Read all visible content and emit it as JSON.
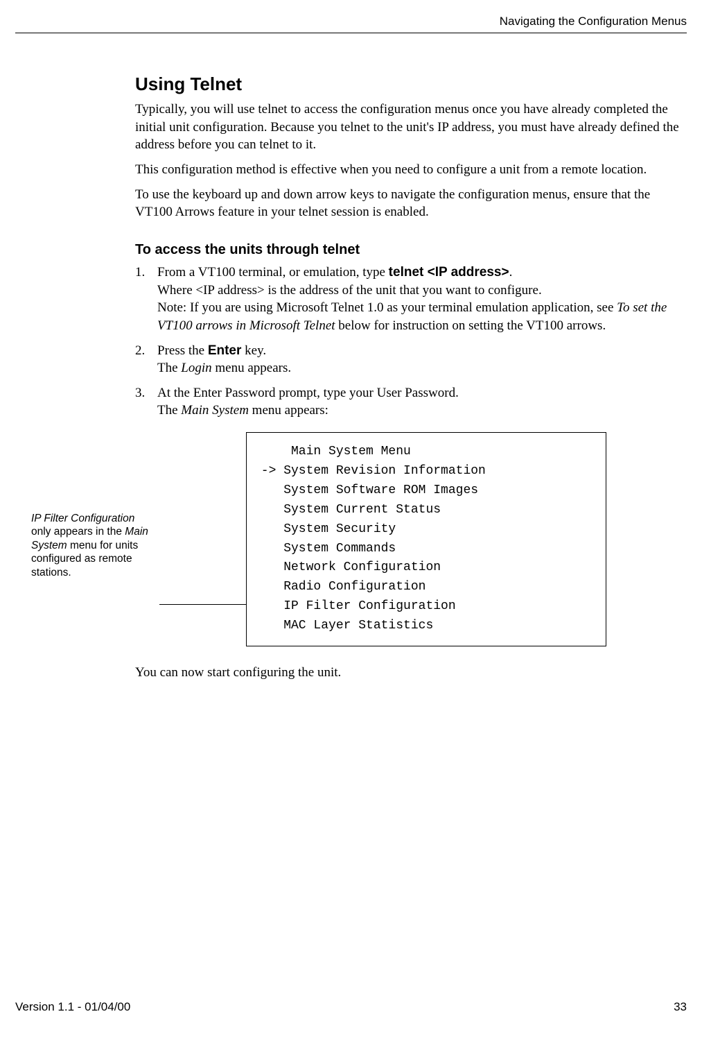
{
  "header": {
    "running_head": "Navigating the Configuration Menus"
  },
  "section": {
    "title": "Using Telnet",
    "para1": "Typically, you will use telnet to access the configuration menus once you have already completed the initial unit configuration. Because you telnet to the unit's IP address, you must have already defined the address before you can telnet to it.",
    "para2": "This configuration method is effective when you need to configure a unit from a remote location.",
    "para3": "To use the keyboard up and down arrow keys to navigate the configuration menus, ensure that the VT100 Arrows feature in your telnet session is enabled.",
    "subhead": "To access the units through telnet",
    "step1_num": "1.",
    "step1_a": "From a VT100 terminal, or emulation, type ",
    "step1_cmd": "telnet <IP address>",
    "step1_b": ".",
    "step1_c": "Where <IP address> is the address of the unit that you want to configure.",
    "step1_d_a": "Note: If you are using Microsoft Telnet 1.0 as your terminal emulation application, see ",
    "step1_d_i": "To set the VT100 arrows in Microsoft Telnet",
    "step1_d_b": " below for instruction on setting the VT100 arrows.",
    "step2_num": "2.",
    "step2_a": "Press the ",
    "step2_key": "Enter",
    "step2_b": " key.",
    "step2_c_a": "The ",
    "step2_c_i": "Login",
    "step2_c_b": " menu appears.",
    "step3_num": "3.",
    "step3_a": "At the Enter Password prompt, type your User Password.",
    "step3_b_a": "The ",
    "step3_b_i": "Main System",
    "step3_b_b": " menu appears:",
    "closing": "You can now start configuring the unit."
  },
  "annotation": {
    "a1_i": "IP Filter Configuration",
    "a1_b": " only appears in the ",
    "a1_i2": "Main System",
    "a1_c": " menu for units configured as remote stations."
  },
  "menu": {
    "title": "     Main System Menu",
    "row1": " -> System Revision Information",
    "row2": "    System Software ROM Images",
    "row3": "    System Current Status",
    "row4": "    System Security",
    "row5": "    System Commands",
    "row6": "    Network Configuration",
    "row7": "    Radio Configuration",
    "row8": "    IP Filter Configuration",
    "row9": "    MAC Layer Statistics"
  },
  "footer": {
    "version": "Version 1.1 - 01/04/00",
    "page": "33"
  }
}
